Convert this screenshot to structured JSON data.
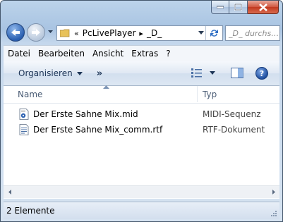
{
  "window": {
    "caption_buttons": {
      "minimize_icon": "minimize-icon",
      "maximize_icon": "maximize-icon",
      "close_icon": "close-icon"
    }
  },
  "address": {
    "prefix": "«",
    "breadcrumbs": [
      "PcLivePlayer",
      "_D_"
    ],
    "separator": "▸",
    "search_placeholder": "_D_ durchs…"
  },
  "menu": [
    "Datei",
    "Bearbeiten",
    "Ansicht",
    "Extras",
    "?"
  ],
  "commandbar": {
    "organize_label": "Organisieren",
    "more_label": "»"
  },
  "columns": {
    "name": "Name",
    "type": "Typ"
  },
  "files": [
    {
      "name": "Der Erste Sahne Mix.mid",
      "type": "MIDI-Sequenz",
      "icon": "midi-file-icon"
    },
    {
      "name": "Der Erste Sahne Mix_comm.rtf",
      "type": "RTF-Dokument",
      "icon": "rtf-file-icon"
    }
  ],
  "status": {
    "count": "2 Elemente"
  },
  "colors": {
    "accent": "#1f4fa0",
    "close_red": "#c2391f",
    "chrome": "#bcd3ea"
  }
}
